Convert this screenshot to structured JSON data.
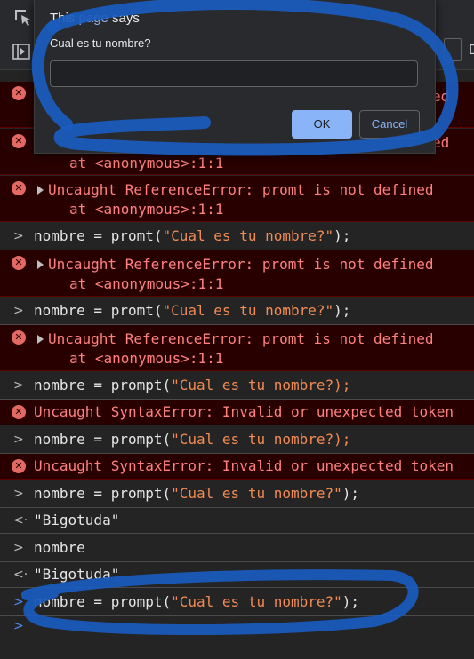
{
  "dialog": {
    "title_prefix": "This ",
    "title_link": "page",
    "title_suffix": " says",
    "message": "Cual es tu nombre?",
    "input_value": "",
    "ok_label": "OK",
    "cancel_label": "Cancel"
  },
  "console": {
    "partial_error_text": "ed",
    "partial_error_location": "at <anonymous>:1:1",
    "messages": [
      {
        "kind": "error",
        "text": "Uncaught ReferenceError: promt is not defined",
        "location": "at <anonymous>:1:1"
      },
      {
        "kind": "input",
        "code_prefix": "nombre = promt(",
        "string": "\"Cual es tu nombre?\"",
        "code_suffix": ");"
      },
      {
        "kind": "error",
        "text": "Uncaught ReferenceError: promt is not defined",
        "location": "at <anonymous>:1:1"
      },
      {
        "kind": "input",
        "code_prefix": "nombre = promt(",
        "string": "\"Cual es tu nombre?\"",
        "code_suffix": ");"
      },
      {
        "kind": "error",
        "text": "Uncaught ReferenceError: promt is not defined",
        "location": "at <anonymous>:1:1"
      },
      {
        "kind": "input",
        "code_prefix": "nombre = prompt(",
        "string": "\"Cual es tu nombre?);",
        "code_suffix": ""
      },
      {
        "kind": "syntax_error",
        "text": "Uncaught SyntaxError: Invalid or unexpected token"
      },
      {
        "kind": "input",
        "code_prefix": "nombre = prompt(",
        "string": "\"Cual es tu nombre?);",
        "code_suffix": ""
      },
      {
        "kind": "syntax_error",
        "text": "Uncaught SyntaxError: Invalid or unexpected token"
      },
      {
        "kind": "input",
        "code_prefix": "nombre = prompt(",
        "string": "\"Cual es tu nombre?\"",
        "code_suffix": ");"
      },
      {
        "kind": "result",
        "string": "\"Bigotuda\""
      },
      {
        "kind": "input",
        "code_prefix": "nombre",
        "string": "",
        "code_suffix": ""
      },
      {
        "kind": "result",
        "string": "\"Bigotuda\""
      },
      {
        "kind": "input",
        "code_prefix": "nombre = prompt(",
        "string": "\"Cual es tu nombre?\"",
        "code_suffix": ");"
      }
    ],
    "edge_char": "D",
    "chevron_input": ">",
    "chevron_result": "<·",
    "error_icon": "✕"
  },
  "colors": {
    "string": "#f28b54",
    "error_text": "#ff8080",
    "error_bg": "#290000",
    "accent_blue": "#8ab4f8",
    "annotation_blue": "#1a5cbf"
  },
  "icons": {
    "inspect": "inspect-element-icon",
    "drawer": "toggle-drawer-icon",
    "error": "error-circle-icon",
    "expand": "expand-triangle-icon",
    "prompt": "chevron-right-icon"
  }
}
